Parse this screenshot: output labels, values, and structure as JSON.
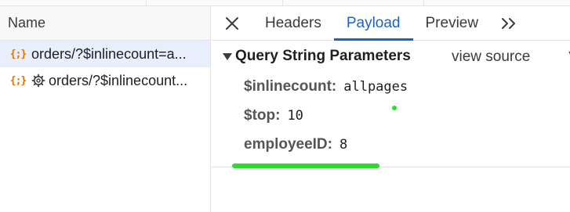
{
  "network_list": {
    "column_header": "Name",
    "requests": [
      {
        "icon": "json-icon",
        "label": "orders/?$inlinecount=a...",
        "selected": true
      },
      {
        "icon": "json-icon",
        "extra_icon": "gear-icon",
        "label": "orders/?$inlinecount...",
        "selected": false
      }
    ]
  },
  "detail_tabs": {
    "close_icon": "close-icon",
    "tabs": [
      {
        "label": "Headers",
        "active": false
      },
      {
        "label": "Payload",
        "active": true
      },
      {
        "label": "Preview",
        "active": false
      }
    ],
    "more_label": ">>"
  },
  "payload": {
    "section_title": "Query String Parameters",
    "view_source_label": "view source",
    "params": [
      {
        "key": "$inlinecount:",
        "value": "allpages"
      },
      {
        "key": "$top:",
        "value": "10"
      },
      {
        "key": "employeeID:",
        "value": "8"
      }
    ]
  },
  "colors": {
    "accent": "#1a64c8",
    "selected_row": "#e8eefb",
    "json_icon": "#e37400",
    "annotation": "#2ddb2d"
  }
}
